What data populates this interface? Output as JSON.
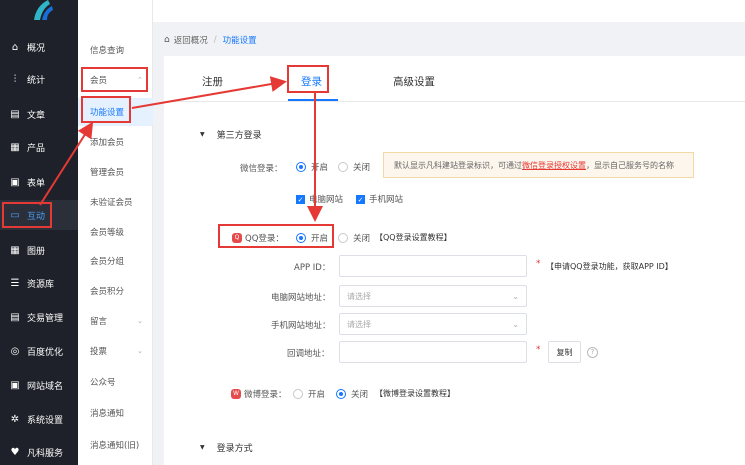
{
  "sidebar": {
    "items": [
      {
        "label": "概况",
        "icon": "home-icon"
      },
      {
        "label": "统计",
        "icon": "chart-icon"
      },
      {
        "label": "文章",
        "icon": "article-icon"
      },
      {
        "label": "产品",
        "icon": "grid-icon"
      },
      {
        "label": "表单",
        "icon": "form-icon"
      },
      {
        "label": "互动",
        "icon": "chat-icon",
        "active": true
      },
      {
        "label": "图册",
        "icon": "gallery-icon"
      },
      {
        "label": "资源库",
        "icon": "database-icon"
      },
      {
        "label": "交易管理",
        "icon": "trade-icon"
      },
      {
        "label": "百度优化",
        "icon": "seo-icon"
      },
      {
        "label": "网站域名",
        "icon": "domain-icon"
      },
      {
        "label": "系统设置",
        "icon": "gear-icon"
      },
      {
        "label": "凡科服务",
        "icon": "heart-icon"
      }
    ]
  },
  "subnav": {
    "items": [
      {
        "label": "信息查询"
      },
      {
        "label": "会员",
        "chev": "⌃"
      },
      {
        "label": "功能设置"
      },
      {
        "label": "添加会员"
      },
      {
        "label": "管理会员"
      },
      {
        "label": "未验证会员"
      },
      {
        "label": "会员等级"
      },
      {
        "label": "会员分组"
      },
      {
        "label": "会员积分"
      },
      {
        "label": "留言",
        "chev": "⌄"
      },
      {
        "label": "投票",
        "chev": "⌄"
      },
      {
        "label": "公众号"
      },
      {
        "label": "消息通知"
      },
      {
        "label": "消息通知(旧)"
      }
    ]
  },
  "breadcrumb": {
    "back": "返回概况",
    "sep": "/",
    "current": "功能设置"
  },
  "tabs": [
    {
      "label": "注册"
    },
    {
      "label": "登录",
      "active": true
    },
    {
      "label": "高级设置"
    }
  ],
  "third_party": {
    "title": "第三方登录",
    "wechat": {
      "label": "微信登录：",
      "on": "开启",
      "off": "关闭",
      "selected": "on",
      "notice_pre": "默认显示凡科建站登录标识，可通过",
      "notice_link": "微信登录授权设置",
      "notice_post": "，显示自己服务号的名称",
      "checkbox_pc": "电脑网站",
      "checkbox_mobile": "手机网站"
    },
    "qq": {
      "label": "QQ登录：",
      "on": "开启",
      "off": "关闭",
      "selected": "on",
      "tutorial": "【QQ登录设置教程】",
      "appid_label": "APP ID：",
      "appid_hint": "【申请QQ登录功能，获取APP ID】",
      "pc_label": "电脑网站地址：",
      "pc_placeholder": "请选择",
      "mobile_label": "手机网站地址：",
      "mobile_placeholder": "请选择",
      "callback_label": "回调地址：",
      "copy_button": "复制",
      "help": "?",
      "required": "*"
    },
    "weibo": {
      "label": "微博登录：",
      "on": "开启",
      "off": "关闭",
      "selected": "off",
      "tutorial": "【微博登录设置教程】"
    }
  },
  "login_method": {
    "title": "登录方式"
  },
  "colors": {
    "accent": "#1677ff",
    "annotation": "#e53935",
    "sidebar_bg": "#1e2129"
  }
}
